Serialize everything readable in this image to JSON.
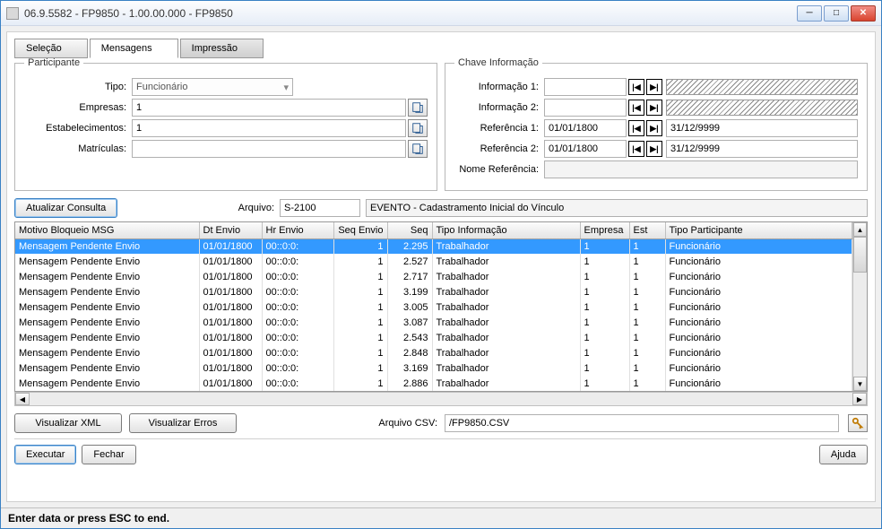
{
  "window": {
    "title": "06.9.5582 - FP9850 - 1.00.00.000 - FP9850"
  },
  "tabs": {
    "selecao": "Seleção",
    "mensagens": "Mensagens",
    "impressao": "Impressão"
  },
  "participante": {
    "legend": "Participante",
    "tipo_label": "Tipo:",
    "tipo_value": "Funcionário",
    "empresas_label": "Empresas:",
    "empresas_value": "1",
    "est_label": "Estabelecimentos:",
    "est_value": "1",
    "matriculas_label": "Matrículas:",
    "matriculas_value": ""
  },
  "chave": {
    "legend": "Chave Informação",
    "info1_label": "Informação 1:",
    "info1_value": "",
    "info2_label": "Informação 2:",
    "info2_value": "",
    "ref1_label": "Referência 1:",
    "ref1_start": "01/01/1800",
    "ref1_end": "31/12/9999",
    "ref2_label": "Referência 2:",
    "ref2_start": "01/01/1800",
    "ref2_end": "31/12/9999",
    "nome_label": "Nome Referência:",
    "nome_value": ""
  },
  "toolbar": {
    "atualizar": "Atualizar Consulta",
    "arquivo_label": "Arquivo:",
    "arquivo_value": "S-2100",
    "evento_value": "EVENTO - Cadastramento Inicial do Vínculo"
  },
  "grid": {
    "headers": {
      "motivo": "Motivo Bloqueio MSG",
      "dt": "Dt Envio",
      "hr": "Hr Envio",
      "seqenv": "Seq Envio",
      "seq": "Seq",
      "tipoinfo": "Tipo Informação",
      "emp": "Empresa",
      "est": "Est",
      "tipopart": "Tipo Participante"
    },
    "rows": [
      {
        "motivo": "Mensagem Pendente Envio",
        "dt": "01/01/1800",
        "hr": "00::0:0:",
        "seqenv": "1",
        "seq": "2.295",
        "tipoinfo": "Trabalhador",
        "emp": "1",
        "est": "1",
        "tipopart": "Funcionário"
      },
      {
        "motivo": "Mensagem Pendente Envio",
        "dt": "01/01/1800",
        "hr": "00::0:0:",
        "seqenv": "1",
        "seq": "2.527",
        "tipoinfo": "Trabalhador",
        "emp": "1",
        "est": "1",
        "tipopart": "Funcionário"
      },
      {
        "motivo": "Mensagem Pendente Envio",
        "dt": "01/01/1800",
        "hr": "00::0:0:",
        "seqenv": "1",
        "seq": "2.717",
        "tipoinfo": "Trabalhador",
        "emp": "1",
        "est": "1",
        "tipopart": "Funcionário"
      },
      {
        "motivo": "Mensagem Pendente Envio",
        "dt": "01/01/1800",
        "hr": "00::0:0:",
        "seqenv": "1",
        "seq": "3.199",
        "tipoinfo": "Trabalhador",
        "emp": "1",
        "est": "1",
        "tipopart": "Funcionário"
      },
      {
        "motivo": "Mensagem Pendente Envio",
        "dt": "01/01/1800",
        "hr": "00::0:0:",
        "seqenv": "1",
        "seq": "3.005",
        "tipoinfo": "Trabalhador",
        "emp": "1",
        "est": "1",
        "tipopart": "Funcionário"
      },
      {
        "motivo": "Mensagem Pendente Envio",
        "dt": "01/01/1800",
        "hr": "00::0:0:",
        "seqenv": "1",
        "seq": "3.087",
        "tipoinfo": "Trabalhador",
        "emp": "1",
        "est": "1",
        "tipopart": "Funcionário"
      },
      {
        "motivo": "Mensagem Pendente Envio",
        "dt": "01/01/1800",
        "hr": "00::0:0:",
        "seqenv": "1",
        "seq": "2.543",
        "tipoinfo": "Trabalhador",
        "emp": "1",
        "est": "1",
        "tipopart": "Funcionário"
      },
      {
        "motivo": "Mensagem Pendente Envio",
        "dt": "01/01/1800",
        "hr": "00::0:0:",
        "seqenv": "1",
        "seq": "2.848",
        "tipoinfo": "Trabalhador",
        "emp": "1",
        "est": "1",
        "tipopart": "Funcionário"
      },
      {
        "motivo": "Mensagem Pendente Envio",
        "dt": "01/01/1800",
        "hr": "00::0:0:",
        "seqenv": "1",
        "seq": "3.169",
        "tipoinfo": "Trabalhador",
        "emp": "1",
        "est": "1",
        "tipopart": "Funcionário"
      },
      {
        "motivo": "Mensagem Pendente Envio",
        "dt": "01/01/1800",
        "hr": "00::0:0:",
        "seqenv": "1",
        "seq": "2.886",
        "tipoinfo": "Trabalhador",
        "emp": "1",
        "est": "1",
        "tipopart": "Funcionário"
      }
    ]
  },
  "footer": {
    "visualizar_xml": "Visualizar XML",
    "visualizar_erros": "Visualizar Erros",
    "arquivo_csv_label": "Arquivo CSV:",
    "arquivo_csv_value": "/FP9850.CSV",
    "executar": "Executar",
    "fechar": "Fechar",
    "ajuda": "Ajuda"
  },
  "status": "Enter data or press ESC to end."
}
